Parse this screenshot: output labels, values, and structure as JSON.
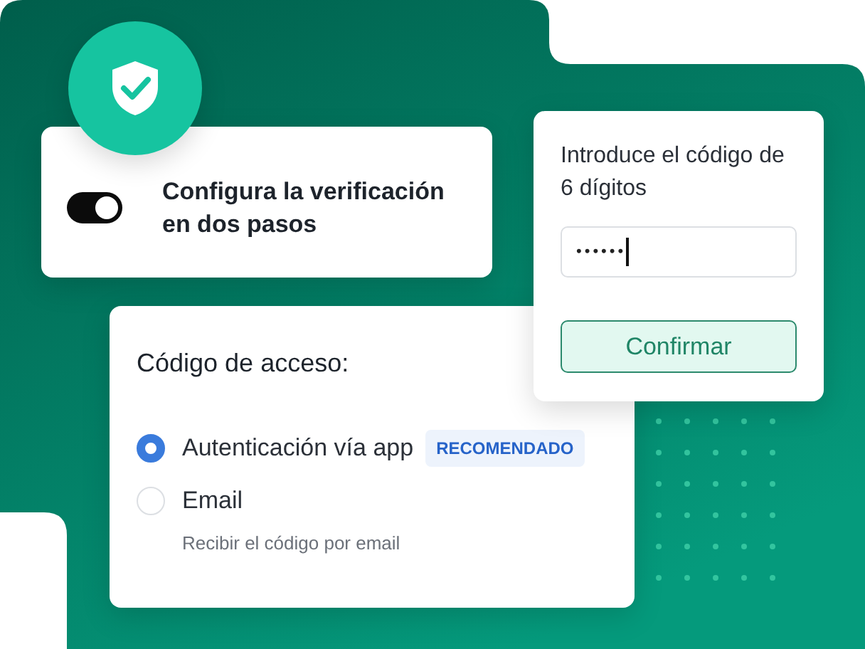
{
  "setup_card": {
    "title": "Configura la verificación en dos pasos",
    "toggle": {
      "on": true
    }
  },
  "code_card": {
    "prompt": "Introduce el código de 6 dígitos",
    "field": {
      "value": "••••••"
    },
    "button": "Confirmar"
  },
  "access_card": {
    "title": "Código de acceso:",
    "options": [
      {
        "label": "Autenticación vía app",
        "badge": "RECOMENDADO",
        "selected": true
      },
      {
        "label": "Email",
        "hint": "Recibir el código por email",
        "selected": false
      }
    ]
  }
}
